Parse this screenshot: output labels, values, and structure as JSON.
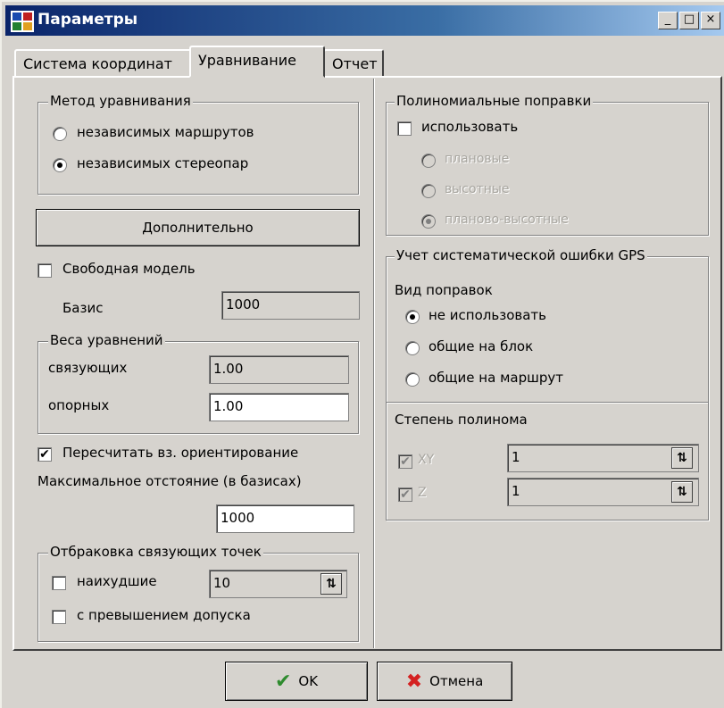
{
  "window": {
    "title": "Параметры"
  },
  "titlebar_buttons": {
    "minimize": "_",
    "maximize": "□",
    "close": "×"
  },
  "tabs": [
    {
      "label": "Система координат",
      "active": false
    },
    {
      "label": "Уравнивание",
      "active": true
    },
    {
      "label": "Отчет",
      "active": false
    }
  ],
  "method_group": {
    "legend": "Метод уравнивания",
    "options": [
      {
        "label": "независимых маршрутов",
        "selected": false
      },
      {
        "label": "независимых стереопар",
        "selected": true
      }
    ]
  },
  "additional_button": "Дополнительно",
  "free_model": {
    "label": "Свободная модель",
    "checked": false
  },
  "basis": {
    "label": "Базис",
    "value": "1000"
  },
  "weights_group": {
    "legend": "Веса уравнений",
    "connecting": {
      "label": "связующих",
      "value": "1.00"
    },
    "control": {
      "label": "опорных",
      "value": "1.00"
    }
  },
  "recalc": {
    "label": "Пересчитать вз. ориентирование",
    "checked": true
  },
  "max_distance": {
    "label": "Максимальное отстояние (в базисах)",
    "value": "1000"
  },
  "rejection_group": {
    "legend": "Отбраковка связующих точек",
    "worst": {
      "label": "наихудшие",
      "checked": false,
      "value": "10"
    },
    "tolerance": {
      "label": "с превышением допуска",
      "checked": false
    }
  },
  "poly_group": {
    "legend": "Полиномиальные поправки",
    "use": {
      "label": "использовать",
      "checked": false
    },
    "options": [
      {
        "label": "плановые",
        "selected": false
      },
      {
        "label": "высотные",
        "selected": false
      },
      {
        "label": "планово-высотные",
        "selected": true
      }
    ]
  },
  "gps_group": {
    "legend": "Учет систематической ошибки GPS",
    "kind_label": "Вид поправок",
    "options": [
      {
        "label": "не использовать",
        "selected": true
      },
      {
        "label": "общие на блок",
        "selected": false
      },
      {
        "label": "общие на маршрут",
        "selected": false
      }
    ],
    "degree_label": "Степень полинома",
    "xy": {
      "label": "XY",
      "checked": true,
      "value": "1"
    },
    "z": {
      "label": "Z",
      "checked": true,
      "value": "1"
    }
  },
  "buttons": {
    "ok": "OK",
    "cancel": "Отмена"
  },
  "icons": {
    "spin": "⇅",
    "check": "✔",
    "cross": "✖"
  }
}
